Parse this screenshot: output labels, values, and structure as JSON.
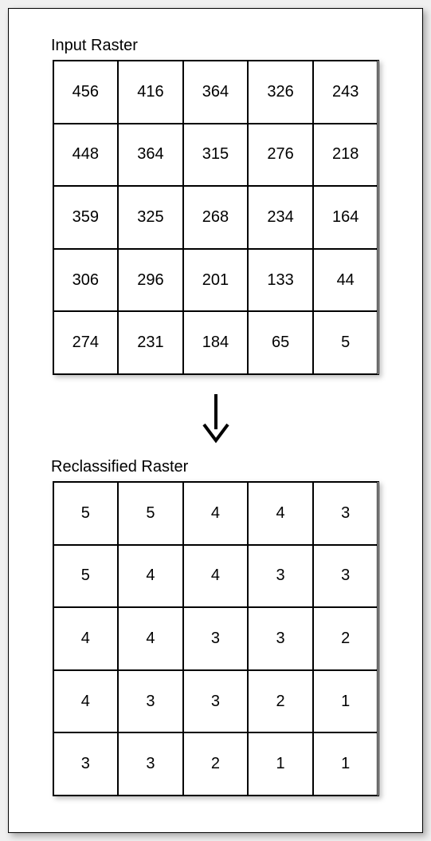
{
  "titles": {
    "input": "Input Raster",
    "reclassified": "Reclassified Raster"
  },
  "input_raster": {
    "rows": 5,
    "cols": 5,
    "values": [
      [
        456,
        416,
        364,
        326,
        243
      ],
      [
        448,
        364,
        315,
        276,
        218
      ],
      [
        359,
        325,
        268,
        234,
        164
      ],
      [
        306,
        296,
        201,
        133,
        44
      ],
      [
        274,
        231,
        184,
        65,
        5
      ]
    ]
  },
  "reclassified_raster": {
    "rows": 5,
    "cols": 5,
    "values": [
      [
        5,
        5,
        4,
        4,
        3
      ],
      [
        5,
        4,
        4,
        3,
        3
      ],
      [
        4,
        4,
        3,
        3,
        2
      ],
      [
        4,
        3,
        3,
        2,
        1
      ],
      [
        3,
        3,
        2,
        1,
        1
      ]
    ]
  }
}
